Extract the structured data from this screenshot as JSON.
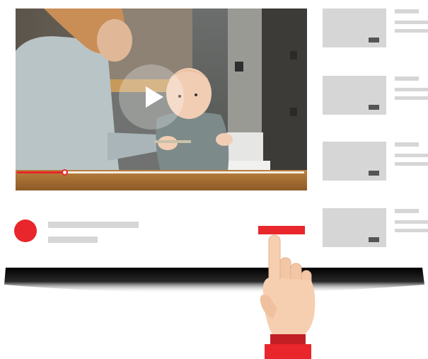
{
  "colors": {
    "accent": "#e8262b",
    "placeholder": "#d6d6d6",
    "badge": "#555555",
    "background": "#ffffff"
  },
  "player": {
    "progress_fraction": 0.165,
    "icons": {
      "play": "play-icon"
    }
  },
  "recommendations": [
    {
      "thumbnail": "thumbnail-placeholder",
      "badge": "duration-badge"
    },
    {
      "thumbnail": "thumbnail-placeholder",
      "badge": "duration-badge"
    },
    {
      "thumbnail": "thumbnail-placeholder",
      "badge": "duration-badge"
    },
    {
      "thumbnail": "thumbnail-placeholder",
      "badge": "duration-badge"
    }
  ],
  "subscribe": {
    "icon": "subscribe-button"
  },
  "illustration": {
    "hand": "pointing-hand-icon"
  }
}
